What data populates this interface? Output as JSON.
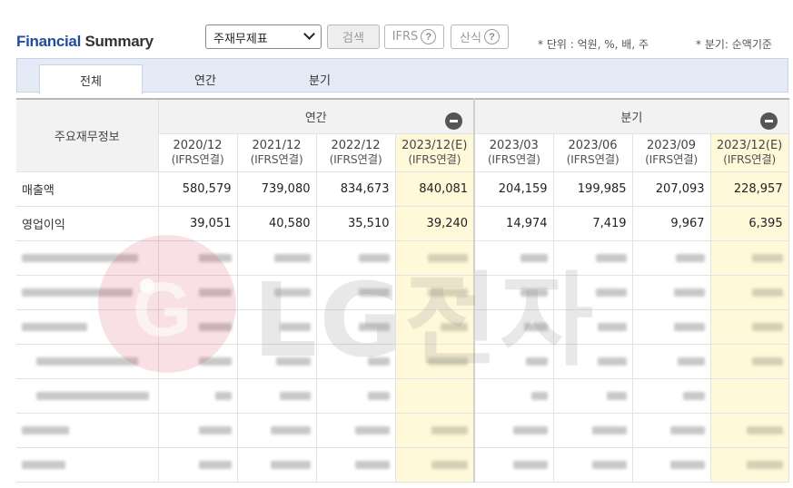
{
  "header": {
    "title_accent": "Financial",
    "title_rest": "Summary",
    "statement_select": "주재무제표",
    "search_button": "검색",
    "ifrs_button": "IFRS",
    "calc_button": "산식",
    "help_icon_glyph": "?",
    "unit_note": "* 단위 : 억원, %, 배, 주",
    "quarter_note": "* 분기: 순액기준"
  },
  "tabs": [
    {
      "label": "전체",
      "active": true
    },
    {
      "label": "연간",
      "active": false
    },
    {
      "label": "분기",
      "active": false
    }
  ],
  "table": {
    "row_header": "주요재무정보",
    "group_annual": "연간",
    "group_quarter": "분기",
    "columns": [
      {
        "period": "2020/12",
        "basis": "(IFRS연결)",
        "estimate": false
      },
      {
        "period": "2021/12",
        "basis": "(IFRS연결)",
        "estimate": false
      },
      {
        "period": "2022/12",
        "basis": "(IFRS연결)",
        "estimate": false
      },
      {
        "period": "2023/12(E)",
        "basis": "(IFRS연결)",
        "estimate": true
      },
      {
        "period": "2023/03",
        "basis": "(IFRS연결)",
        "estimate": false
      },
      {
        "period": "2023/06",
        "basis": "(IFRS연결)",
        "estimate": false
      },
      {
        "period": "2023/09",
        "basis": "(IFRS연결)",
        "estimate": false
      },
      {
        "period": "2023/12(E)",
        "basis": "(IFRS연결)",
        "estimate": true
      }
    ],
    "rows": [
      {
        "label": "매출액",
        "values": [
          "580,579",
          "739,080",
          "834,673",
          "840,081",
          "204,159",
          "199,985",
          "207,093",
          "228,957"
        ]
      },
      {
        "label": "영업이익",
        "values": [
          "39,051",
          "40,580",
          "35,510",
          "39,240",
          "14,974",
          "7,419",
          "9,967",
          "6,395"
        ]
      }
    ]
  },
  "watermark": {
    "logo_letter": "LG",
    "text": "LG전자"
  },
  "colors": {
    "title_accent": "#1f4e9c",
    "estimate_column": "#fff9d9",
    "tab_bar": "#e4ebf6"
  }
}
